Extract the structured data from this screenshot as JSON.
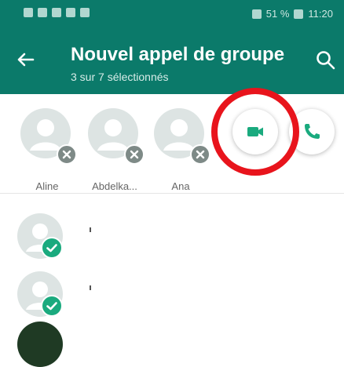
{
  "status_bar": {
    "battery": "51 %",
    "time": "11:20"
  },
  "app_bar": {
    "title": "Nouvel appel de groupe",
    "subtitle": "3 sur 7 sélectionnés",
    "back_icon": "arrow-left-icon",
    "search_icon": "search-icon"
  },
  "selected_contacts": [
    {
      "name": "Aline"
    },
    {
      "name": "Abdelka..."
    },
    {
      "name": "Ana"
    }
  ],
  "call_actions": {
    "video_icon": "video-camera-icon",
    "voice_icon": "phone-icon"
  },
  "colors": {
    "header": "#0b7a6a",
    "accent": "#1aaa7e",
    "highlight": "#e8141c"
  }
}
